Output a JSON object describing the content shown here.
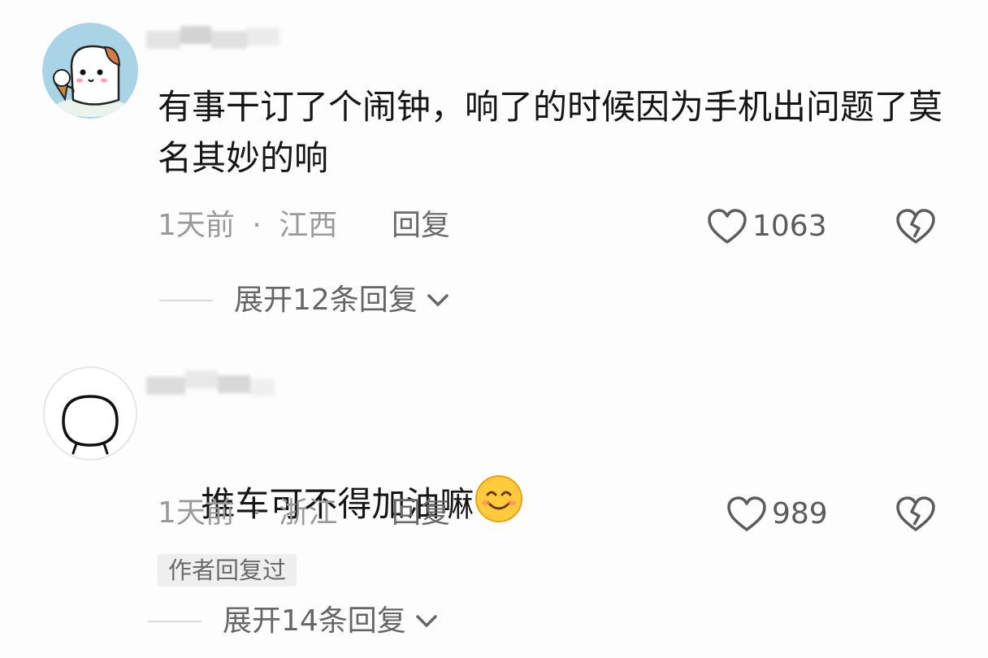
{
  "comments": [
    {
      "text": "有事干订了个闹钟，响了的时候因为手机出问题了莫名其妙的响",
      "time": "1天前",
      "separator": "·",
      "location": "江西",
      "reply_label": "回复",
      "likes": "1063",
      "expand_label": "展开12条回复",
      "avatar_icon": "hamster-with-ice-cream-icon"
    },
    {
      "text": "推车可不得加油嘛",
      "emoji_icon": "smiling-face-emoji",
      "time": "1天前",
      "separator": "·",
      "location": "浙江",
      "reply_label": "回复",
      "likes": "989",
      "author_badge": "作者回复过",
      "expand_label": "展开14条回复",
      "avatar_icon": "doodle-face-icon"
    }
  ],
  "colors": {
    "text": "#161616",
    "meta": "#9a9a9a",
    "reply": "#6a6a6a",
    "badge_bg": "#efefef",
    "avatar1_bg": "#a8d3e4"
  }
}
